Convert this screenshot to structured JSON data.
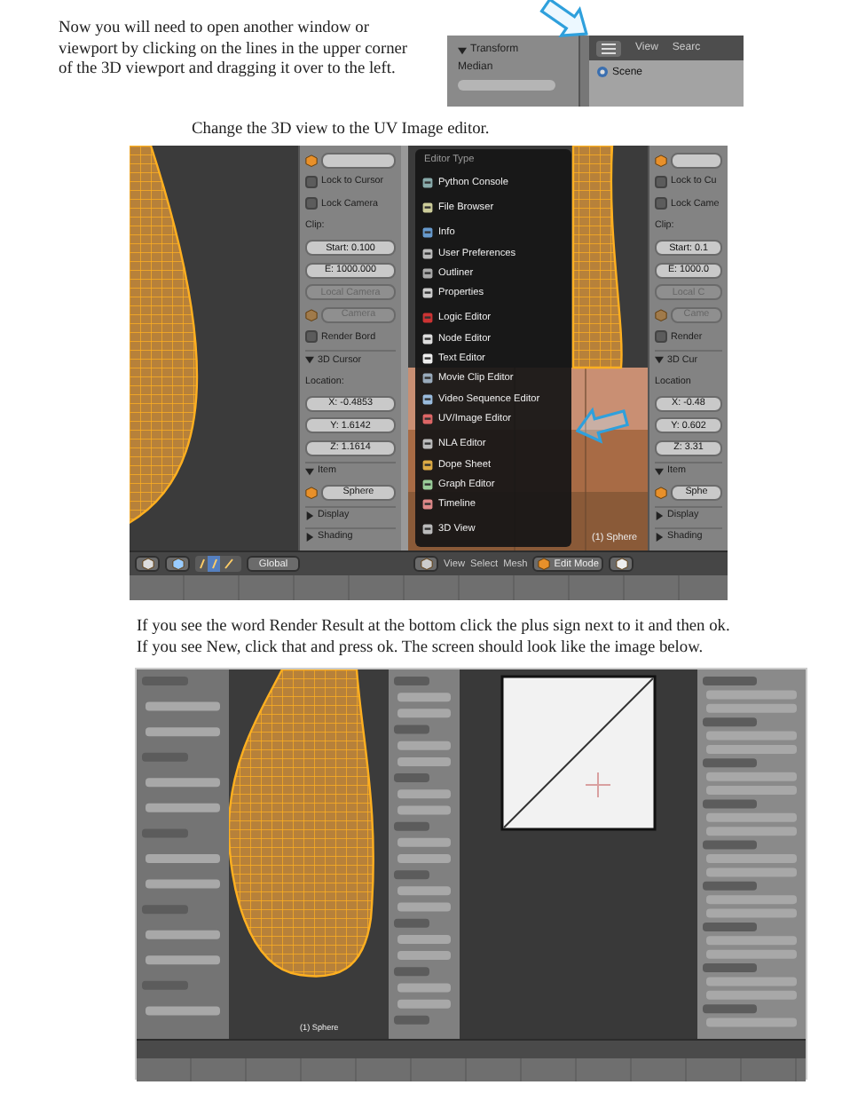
{
  "intro": "Now you will need to open another window or viewport by clicking on the lines in the upper corner of the 3D viewport and dragging it over to the left.",
  "corner_screenshot": {
    "panel_title": "Transform",
    "field_label": "Median",
    "header_items": [
      "View",
      "Searc"
    ],
    "outliner_item": "Scene"
  },
  "caption": "Change the 3D view to the UV Image editor.",
  "editor_screenshot": {
    "left_panel": [
      {
        "kind": "icon-field",
        "disabled": false
      },
      {
        "kind": "check",
        "label": "Lock to Cursor",
        "checked": false
      },
      {
        "kind": "check",
        "label": "Lock Camera",
        "checked": false
      },
      {
        "kind": "label",
        "label": "Clip:"
      },
      {
        "kind": "field",
        "label": "Start: 0.100",
        "disabled": false
      },
      {
        "kind": "field",
        "label": "E: 1000.000",
        "disabled": false
      },
      {
        "kind": "field",
        "label": "Local Camera",
        "disabled": true
      },
      {
        "kind": "icon-field",
        "label": "Camera",
        "disabled": true
      },
      {
        "kind": "check",
        "label": "Render Bord",
        "checked": false
      },
      {
        "kind": "section",
        "label": "3D Cursor",
        "expanded": true
      },
      {
        "kind": "label",
        "label": "Location:"
      },
      {
        "kind": "field",
        "label": "X: -0.4853",
        "disabled": false
      },
      {
        "kind": "field",
        "label": "Y: 1.6142",
        "disabled": false
      },
      {
        "kind": "field",
        "label": "Z: 1.1614",
        "disabled": false
      },
      {
        "kind": "section",
        "label": "Item",
        "expanded": true
      },
      {
        "kind": "icon-field",
        "label": "Sphere",
        "disabled": false
      },
      {
        "kind": "section",
        "label": "Display",
        "expanded": false
      },
      {
        "kind": "section",
        "label": "Shading",
        "expanded": false
      }
    ],
    "menu": {
      "title": "Editor Type",
      "groups": [
        [
          "Python Console"
        ],
        [
          "File Browser"
        ],
        [
          "Info",
          "User Preferences",
          "Outliner",
          "Properties"
        ],
        [
          "Logic Editor",
          "Node Editor",
          "Text Editor",
          "Movie Clip Editor",
          "Video Sequence Editor",
          "UV/Image Editor"
        ],
        [
          "NLA Editor",
          "Dope Sheet",
          "Graph Editor",
          "Timeline"
        ],
        [
          "3D View"
        ]
      ]
    },
    "viewport_label": "(1) Sphere",
    "header_left": [
      "Global"
    ],
    "header_right": [
      "View",
      "Select",
      "Mesh",
      "Edit Mode"
    ],
    "right_panel": [
      {
        "kind": "icon-field",
        "disabled": false
      },
      {
        "kind": "check",
        "label": "Lock to Cu",
        "checked": false
      },
      {
        "kind": "check",
        "label": "Lock Came",
        "checked": false
      },
      {
        "kind": "label",
        "label": "Clip:"
      },
      {
        "kind": "field",
        "label": "Start: 0.1",
        "disabled": false
      },
      {
        "kind": "field",
        "label": "E: 1000.0",
        "disabled": false
      },
      {
        "kind": "field",
        "label": "Local C",
        "disabled": true
      },
      {
        "kind": "icon-field",
        "label": "Came",
        "disabled": true
      },
      {
        "kind": "check",
        "label": "Render",
        "checked": false
      },
      {
        "kind": "section",
        "label": "3D Cur",
        "expanded": true
      },
      {
        "kind": "label",
        "label": "Location"
      },
      {
        "kind": "field",
        "label": "X: -0.48",
        "disabled": false
      },
      {
        "kind": "field",
        "label": "Y: 0.602",
        "disabled": false
      },
      {
        "kind": "field",
        "label": "Z: 3.31",
        "disabled": false
      },
      {
        "kind": "section",
        "label": "Item",
        "expanded": true
      },
      {
        "kind": "icon-field",
        "label": "Sphe",
        "disabled": false
      },
      {
        "kind": "section",
        "label": "Display",
        "expanded": false
      },
      {
        "kind": "section",
        "label": "Shading",
        "expanded": false
      }
    ]
  },
  "instructions": [
    "If you see the word Render Result  at the bottom click the plus sign next to it and then ok.",
    "If you see New, click that and press ok. The screen should look like the image below."
  ],
  "result_screenshot": {
    "viewport_label": "(1) Sphere"
  }
}
